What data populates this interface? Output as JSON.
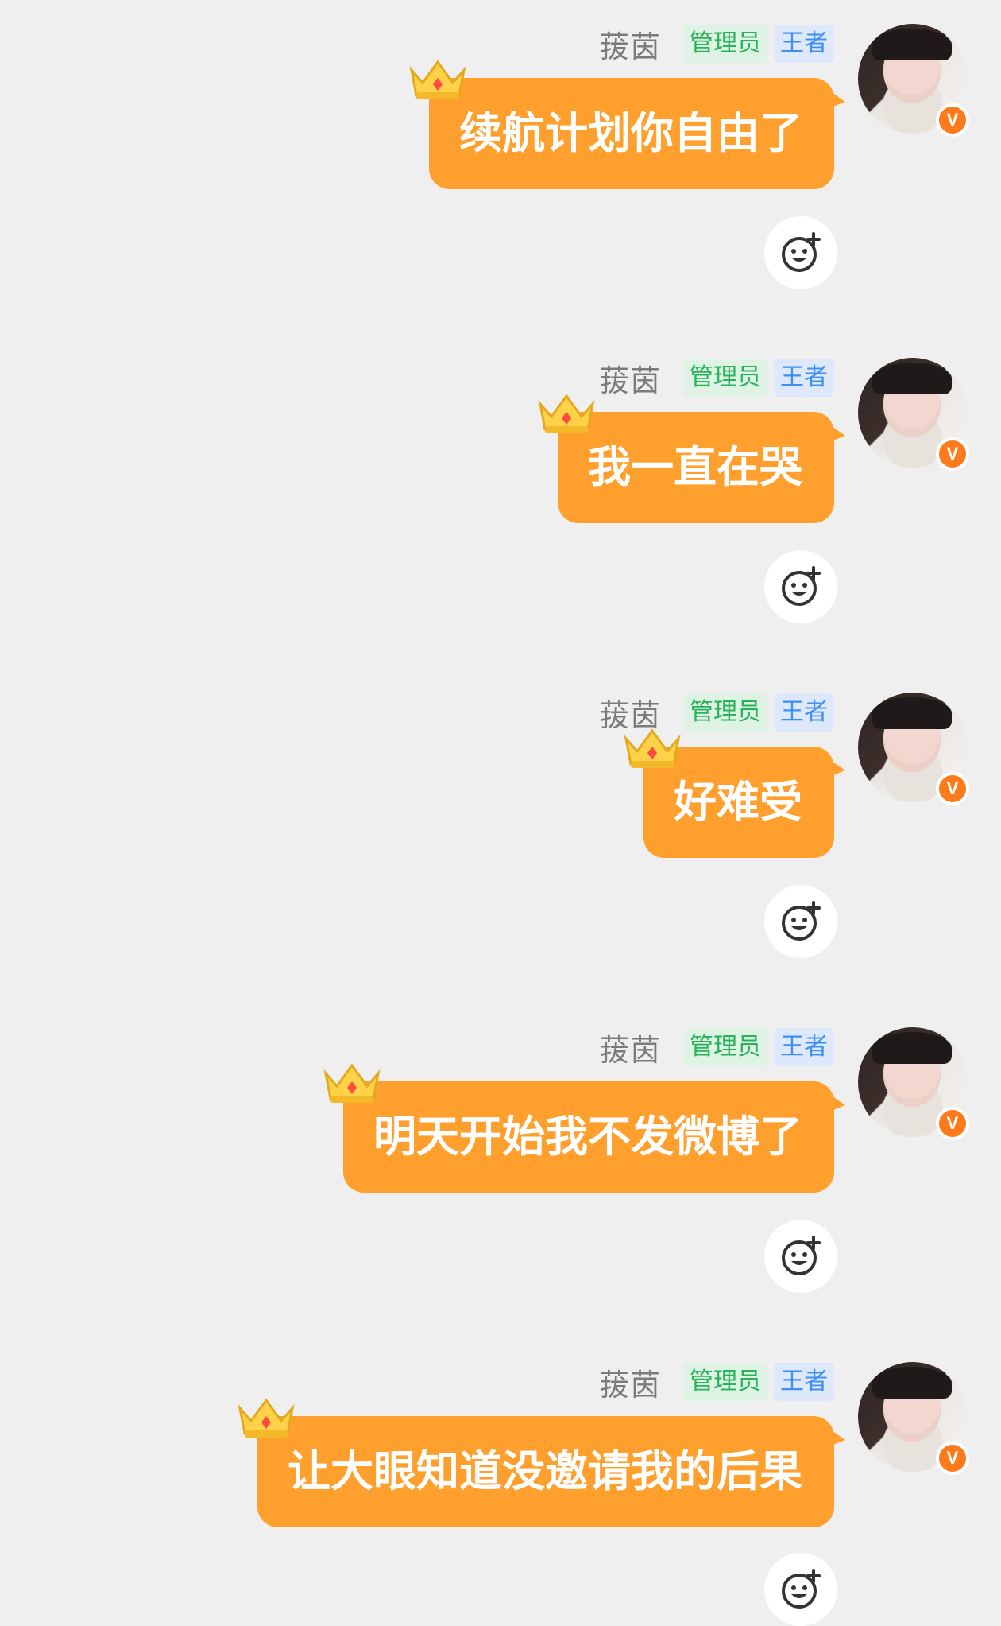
{
  "messages": [
    {
      "user": "菝茵",
      "badges": [
        "管理员",
        "王者"
      ],
      "text": "续航计划你自由了"
    },
    {
      "user": "菝茵",
      "badges": [
        "管理员",
        "王者"
      ],
      "text": "我一直在哭"
    },
    {
      "user": "菝茵",
      "badges": [
        "管理员",
        "王者"
      ],
      "text": "好难受"
    },
    {
      "user": "菝茵",
      "badges": [
        "管理员",
        "王者"
      ],
      "text": "明天开始我不发微博了"
    },
    {
      "user": "菝茵",
      "badges": [
        "管理员",
        "王者"
      ],
      "text": "让大眼知道没邀请我的后果"
    }
  ],
  "verified_mark": "V",
  "colors": {
    "background": "#efefef",
    "bubble": "#ff9f2d",
    "admin_badge_text": "#28b35a",
    "king_badge_text": "#3f8ff0",
    "verified": "#ff7a1a"
  },
  "icons": {
    "crown": "crown-icon",
    "reaction": "add-emoji-reaction-icon",
    "verified": "verified-icon"
  }
}
